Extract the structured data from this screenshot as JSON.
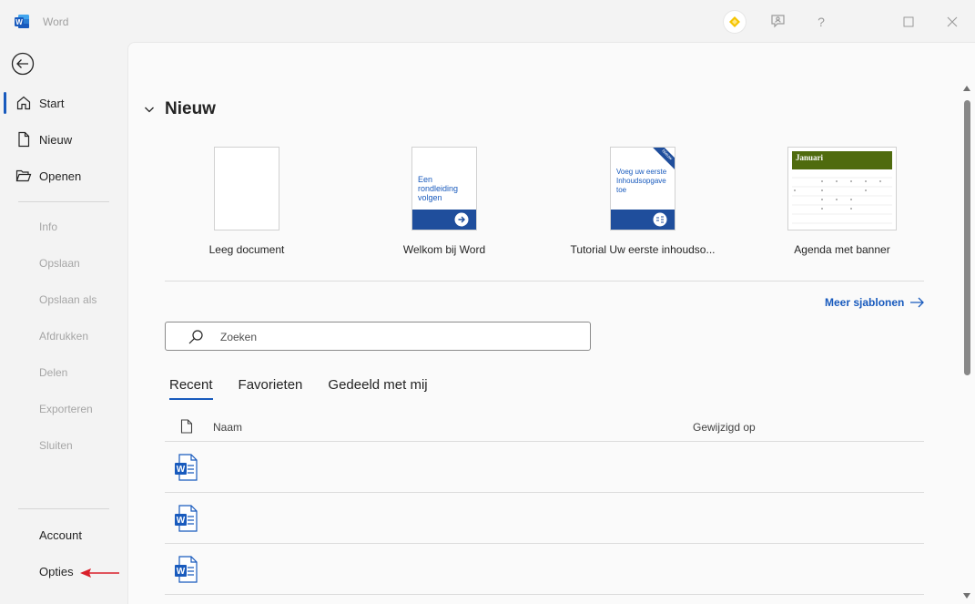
{
  "app": {
    "title": "Word"
  },
  "titlebar": {
    "help_label": "?"
  },
  "sidebar": {
    "items": [
      {
        "label": "Start",
        "icon": "home-icon",
        "active": true
      },
      {
        "label": "Nieuw",
        "icon": "new-document-icon"
      },
      {
        "label": "Openen",
        "icon": "folder-open-icon"
      }
    ],
    "disabled_items": [
      "Info",
      "Opslaan",
      "Opslaan als",
      "Afdrukken",
      "Delen",
      "Exporteren",
      "Sluiten"
    ],
    "bottom_items": [
      "Account",
      "Opties"
    ]
  },
  "main": {
    "section_title": "Nieuw",
    "templates": [
      {
        "name": "Leeg document"
      },
      {
        "name": "Welkom bij Word",
        "thumb_text": "Een rondleiding volgen"
      },
      {
        "name": "Tutorial Uw eerste inhoudso...",
        "thumb_text": "Voeg uw eerste Inhoudsopgave toe",
        "badge": "Nieuw"
      },
      {
        "name": "Agenda met banner",
        "thumb_text": "Januari"
      }
    ],
    "more_templates": "Meer sjablonen",
    "search": {
      "placeholder": "Zoeken",
      "value": ""
    },
    "tabs": [
      {
        "label": "Recent",
        "active": true
      },
      {
        "label": "Favorieten"
      },
      {
        "label": "Gedeeld met mij"
      }
    ],
    "columns": {
      "name": "Naam",
      "modified": "Gewijzigd op"
    },
    "recent_files": [
      {},
      {},
      {}
    ]
  },
  "colors": {
    "accent": "#185abd",
    "word_blue": "#185abd",
    "calendar_green": "#4f6b0e",
    "premium_yellow": "#f5c400",
    "annotation_red": "#d9202a"
  }
}
